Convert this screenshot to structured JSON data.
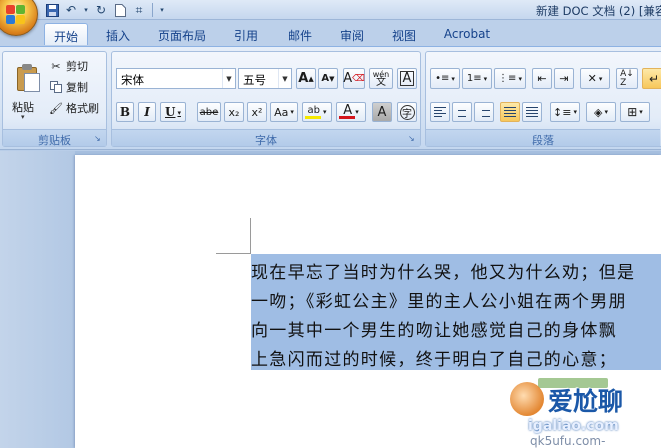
{
  "window": {
    "title": "新建 DOC 文档 (2) [兼容"
  },
  "quick_access": {
    "save_icon": "save-icon",
    "undo_icon": "undo-icon",
    "redo_icon": "redo-icon",
    "new_icon": "new-document-icon",
    "format_icon": "format-painter-icon",
    "customize_icon": "customize-dropdown-icon"
  },
  "tabs": [
    {
      "label": "开始",
      "active": true
    },
    {
      "label": "插入",
      "active": false
    },
    {
      "label": "页面布局",
      "active": false
    },
    {
      "label": "引用",
      "active": false
    },
    {
      "label": "邮件",
      "active": false
    },
    {
      "label": "审阅",
      "active": false
    },
    {
      "label": "视图",
      "active": false
    },
    {
      "label": "Acrobat",
      "active": false
    }
  ],
  "clipboard": {
    "group_label": "剪贴板",
    "paste_label": "粘贴",
    "cut_label": "剪切",
    "copy_label": "复制",
    "format_painter_label": "格式刷"
  },
  "font": {
    "group_label": "字体",
    "font_name": "宋体",
    "font_size": "五号",
    "grow_label": "A",
    "shrink_label": "A",
    "clear_label": "A",
    "phonetic_label": "wén",
    "border_label": "A",
    "bold_label": "B",
    "italic_label": "I",
    "underline_label": "U",
    "strike_label": "abe",
    "subscript_label": "x₂",
    "superscript_label": "x²",
    "case_label": "Aa",
    "highlight_label": "ab",
    "color_label": "A",
    "shade_label": "A",
    "enclose_label": "字",
    "highlight_color": "#f5e800",
    "font_color": "#d3141b"
  },
  "paragraph": {
    "group_label": "段落"
  },
  "document": {
    "lines": [
      "现在早忘了当时为什么哭，他又为什么劝；但是",
      "一吻；《彩虹公主》里的主人公小姐在两个男朋",
      "向一其中一个男生的吻让她感觉自己的身体飘",
      "上急闪而过的时候，终于明白了自己的心意；"
    ],
    "selection_color": "#9fbde4"
  },
  "watermark": {
    "name": "爱尬聊",
    "url": "igaliao.com",
    "url2": "qk5ufu.com-"
  }
}
